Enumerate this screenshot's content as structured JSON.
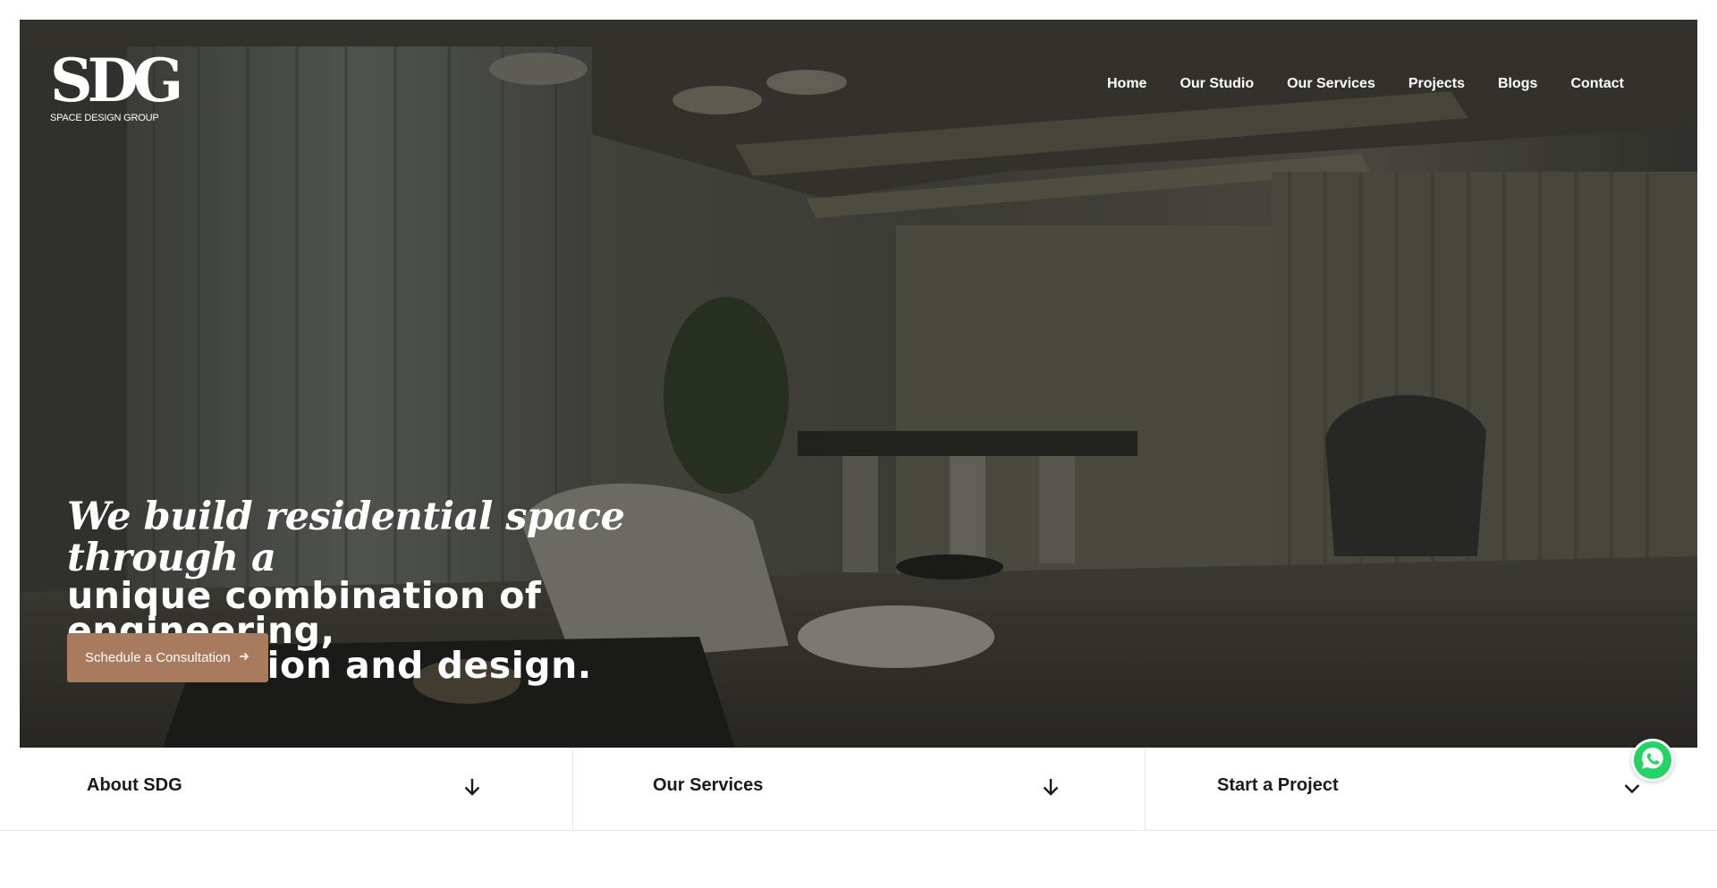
{
  "brand": {
    "logo_mark": "SDG",
    "logo_subtitle": "SPACE DESIGN GROUP"
  },
  "nav": {
    "items": [
      {
        "label": "Home"
      },
      {
        "label": "Our Studio"
      },
      {
        "label": "Our Services"
      },
      {
        "label": "Projects"
      },
      {
        "label": "Blogs"
      },
      {
        "label": "Contact"
      }
    ]
  },
  "hero": {
    "headline_italic": "We build residential space through a",
    "headline_line2": "unique combination of engineering,",
    "headline_line3": "construction and design.",
    "cta_label": "Schedule a Consultation",
    "cta_icon": "arrow-right-icon",
    "cta_color": "#a87a5e"
  },
  "tiles": [
    {
      "label": "About SDG",
      "icon": "arrow-down-icon"
    },
    {
      "label": "Our Services",
      "icon": "arrow-down-icon"
    },
    {
      "label": "Start a Project",
      "icon": "chevron-down-icon"
    }
  ],
  "floating": {
    "whatsapp_icon": "whatsapp-icon",
    "whatsapp_color": "#25d366"
  }
}
